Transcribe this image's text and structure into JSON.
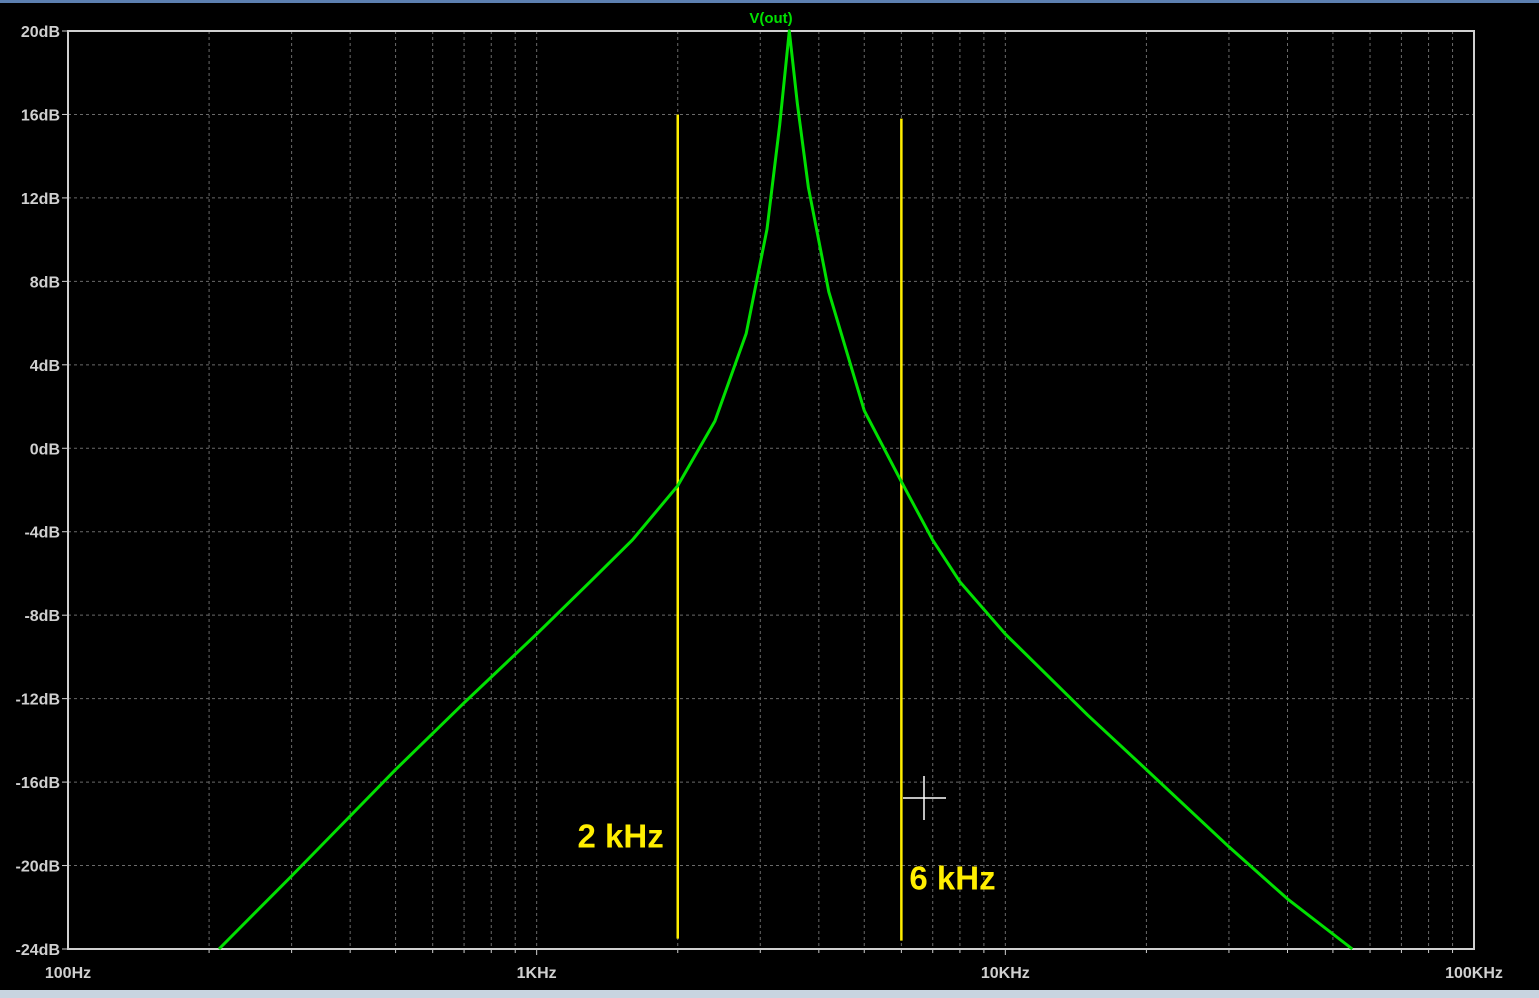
{
  "window": {
    "background": "#000000"
  },
  "chart_data": {
    "type": "line",
    "title": "V(out)",
    "x_scale": "log",
    "xlim": [
      100,
      100000
    ],
    "ylim": [
      -24,
      20
    ],
    "x_ticks": [
      {
        "value": 100,
        "label": "100Hz"
      },
      {
        "value": 1000,
        "label": "1KHz"
      },
      {
        "value": 10000,
        "label": "10KHz"
      },
      {
        "value": 100000,
        "label": "100KHz"
      }
    ],
    "y_ticks": [
      {
        "value": 20,
        "label": "20dB"
      },
      {
        "value": 16,
        "label": "16dB"
      },
      {
        "value": 12,
        "label": "12dB"
      },
      {
        "value": 8,
        "label": "8dB"
      },
      {
        "value": 4,
        "label": "4dB"
      },
      {
        "value": 0,
        "label": "0dB"
      },
      {
        "value": -4,
        "label": "-4dB"
      },
      {
        "value": -8,
        "label": "-8dB"
      },
      {
        "value": -12,
        "label": "-12dB"
      },
      {
        "value": -16,
        "label": "-16dB"
      },
      {
        "value": -20,
        "label": "-20dB"
      },
      {
        "value": -24,
        "label": "-24dB"
      }
    ],
    "grid": true,
    "series": [
      {
        "name": "V(out)",
        "color": "#00e000",
        "x": [
          210,
          300,
          500,
          700,
          1000,
          1300,
          1600,
          2000,
          2400,
          2800,
          3100,
          3300,
          3460,
          3600,
          3800,
          4200,
          5000,
          6000,
          7000,
          8000,
          10000,
          15000,
          20000,
          30000,
          40000,
          55000
        ],
        "y": [
          -24,
          -20.5,
          -15.4,
          -12.2,
          -8.9,
          -6.4,
          -4.4,
          -1.8,
          1.3,
          5.5,
          10.5,
          15.5,
          20,
          16.5,
          12.5,
          7.5,
          1.8,
          -1.6,
          -4.4,
          -6.4,
          -8.9,
          -12.8,
          -15.4,
          -19.1,
          -21.6,
          -24
        ]
      }
    ],
    "markers": [
      {
        "x": 2000,
        "label": "2 kHz",
        "color": "#ffee00",
        "y_top": 16,
        "y_bottom": -23.5
      },
      {
        "x": 6000,
        "label": "6 kHz",
        "color": "#ffee00",
        "y_top": 15.8,
        "y_bottom": -23.6
      }
    ],
    "colors": {
      "axis": "#d0d0d0",
      "grid": "#6a6a6a",
      "tick_label": "#d0d0d0",
      "title": "#00e000"
    }
  }
}
